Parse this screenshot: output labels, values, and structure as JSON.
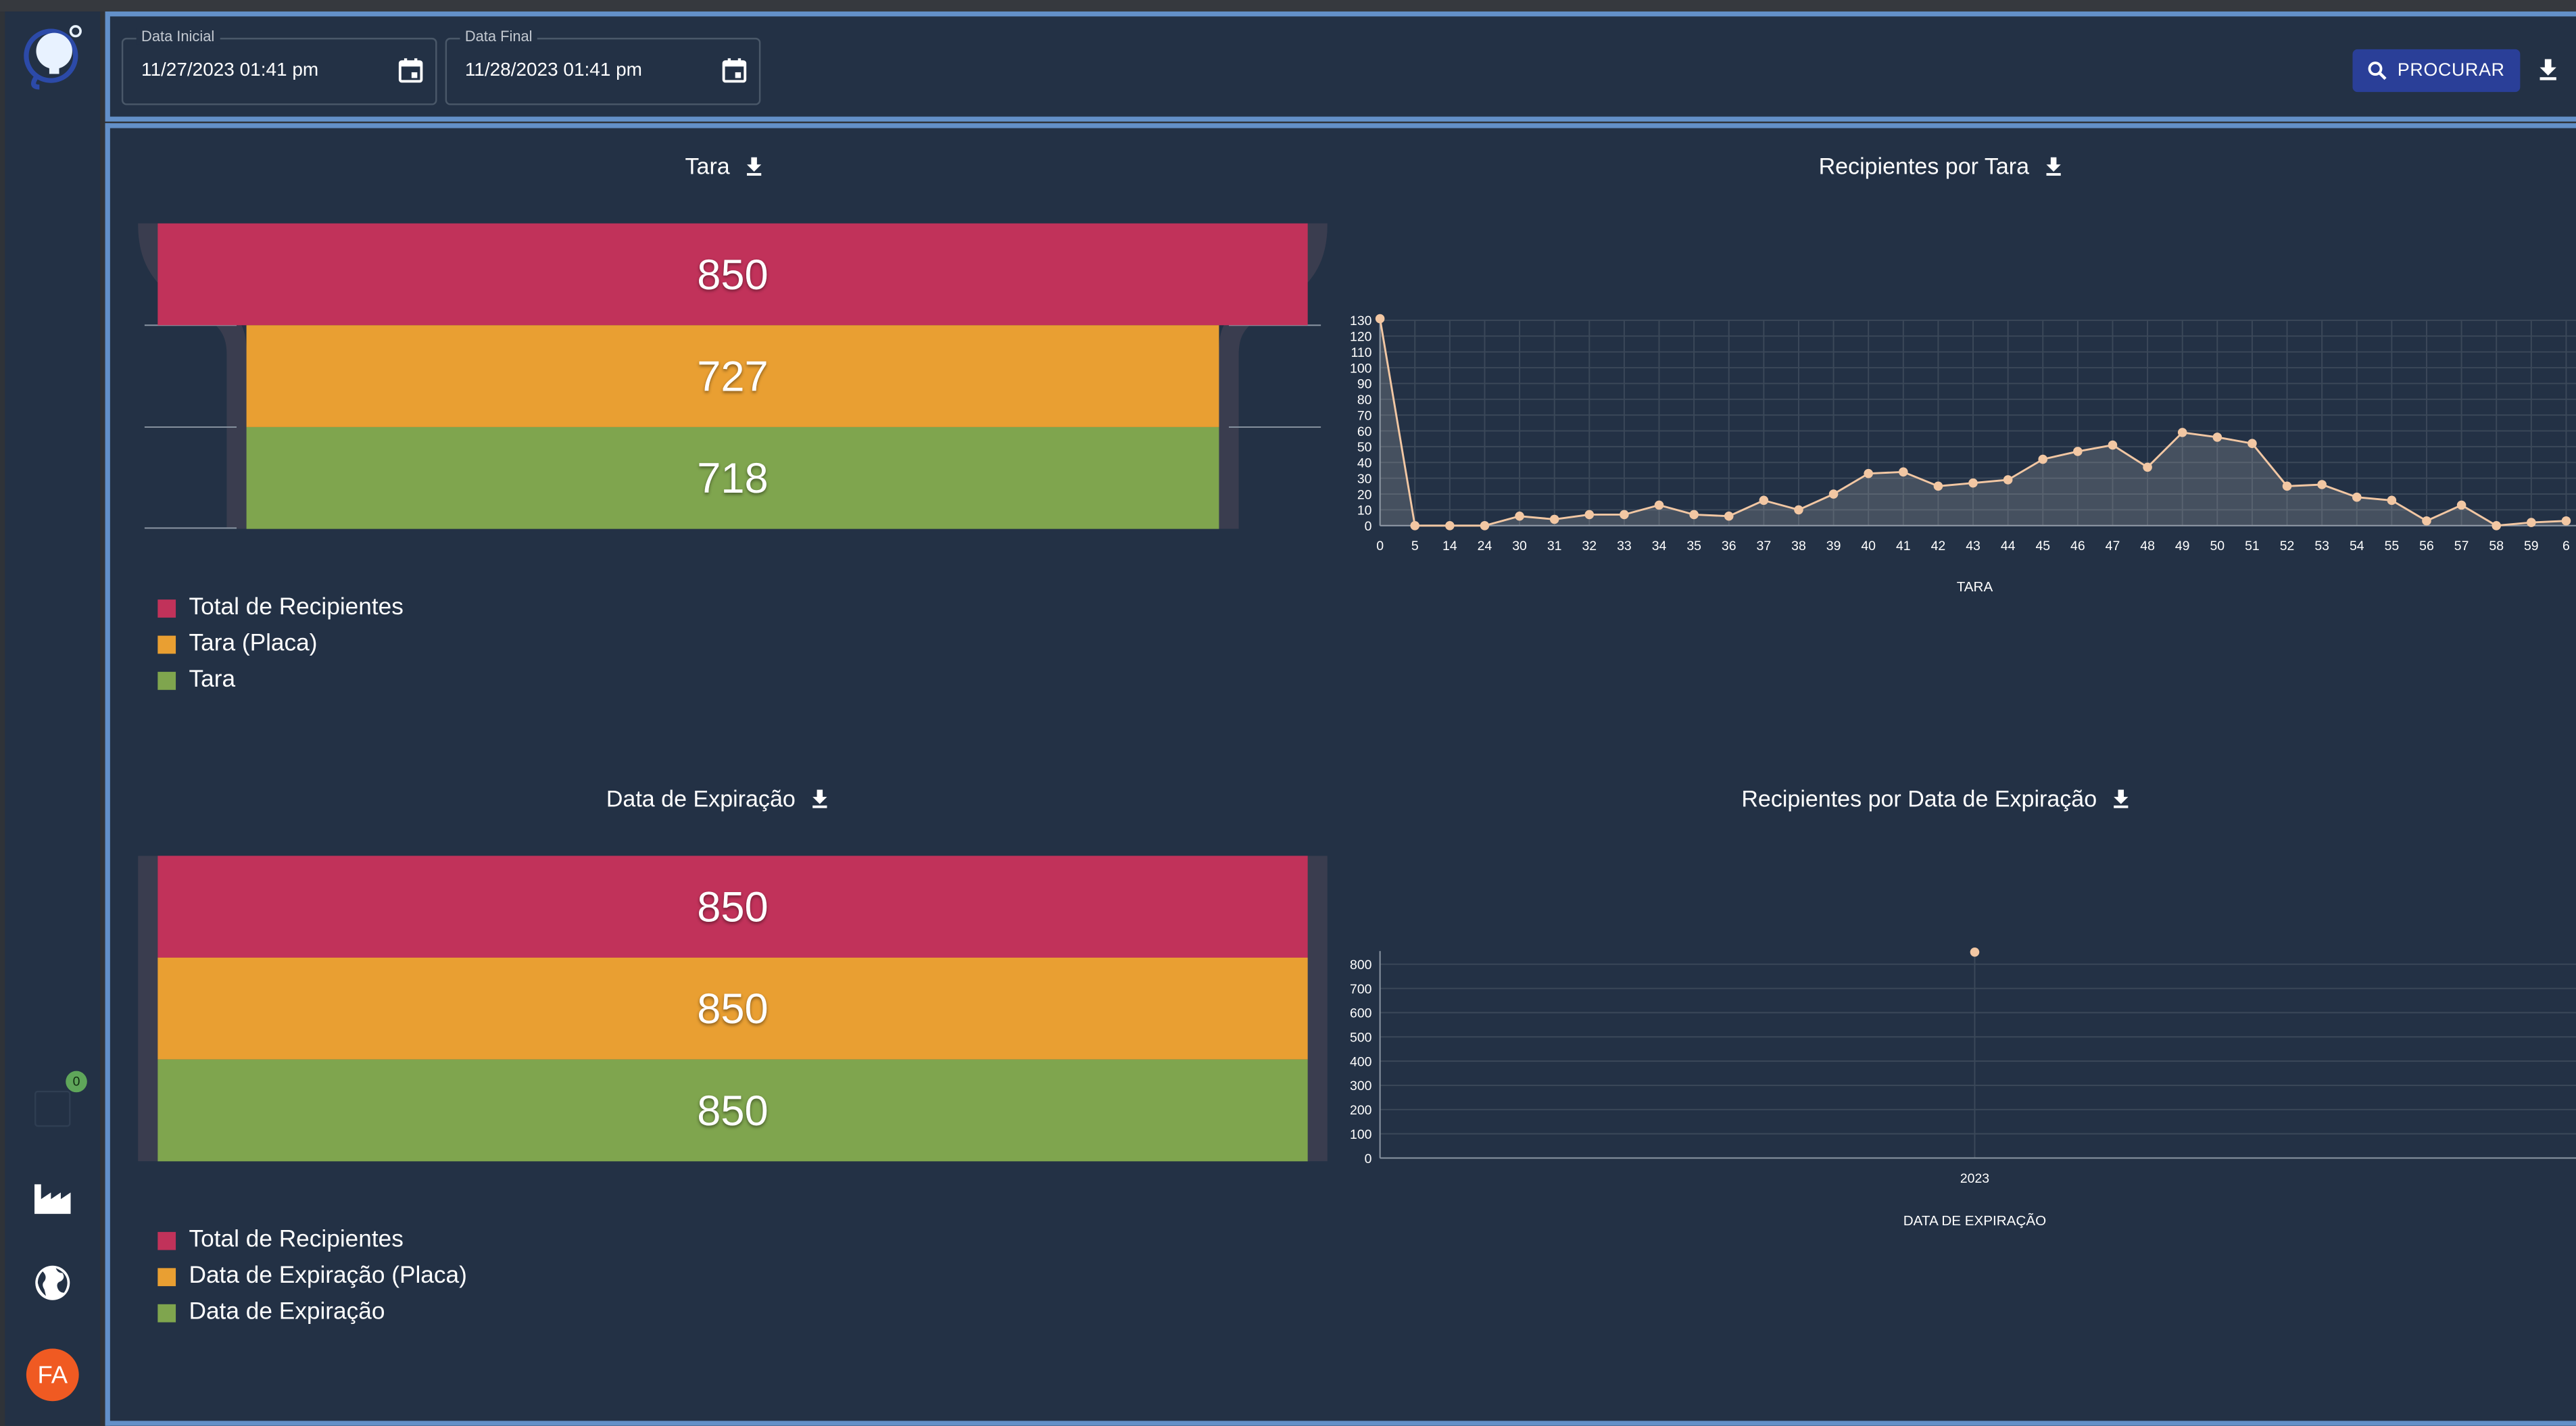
{
  "filters": {
    "start_label": "Data Inicial",
    "start_value": "11/27/2023 01:41 pm",
    "end_label": "Data Final",
    "end_value": "11/28/2023 01:41 pm",
    "search_label": "PROCURAR"
  },
  "sidebar": {
    "notification_count": "0",
    "avatar_initials": "FA"
  },
  "colors": {
    "total": "#c1325a",
    "placa": "#e99f32",
    "base": "#7fa54e",
    "line": "#f2c7a3"
  },
  "tara_funnel": {
    "title": "Tara",
    "values": [
      850,
      727,
      718
    ],
    "labels": [
      "850",
      "727",
      "718"
    ],
    "legend": [
      "Total de Recipientes",
      "Tara (Placa)",
      "Tara"
    ]
  },
  "expiracao_funnel": {
    "title": "Data de Expiração",
    "values": [
      850,
      850,
      850
    ],
    "labels": [
      "850",
      "850",
      "850"
    ],
    "legend": [
      "Total de Recipientes",
      "Data de Expiração (Placa)",
      "Data de Expiração"
    ]
  },
  "chart_data": [
    {
      "type": "line",
      "title": "Recipientes por Tara",
      "xlabel": "TARA",
      "ylabel": "",
      "ylim": [
        0,
        130
      ],
      "yticks": [
        0,
        10,
        20,
        30,
        40,
        50,
        60,
        70,
        80,
        90,
        100,
        110,
        120,
        130
      ],
      "grid": true,
      "categories": [
        "0",
        "5",
        "14",
        "24",
        "30",
        "31",
        "32",
        "33",
        "34",
        "35",
        "36",
        "37",
        "38",
        "39",
        "40",
        "41",
        "42",
        "43",
        "44",
        "45",
        "46",
        "47",
        "48",
        "49",
        "50",
        "51",
        "52",
        "53",
        "54",
        "55",
        "56",
        "57",
        "58",
        "59",
        "6"
      ],
      "values": [
        131,
        0,
        0,
        0,
        6,
        4,
        7,
        7,
        13,
        7,
        6,
        16,
        10,
        20,
        33,
        34,
        25,
        27,
        29,
        42,
        47,
        51,
        37,
        59,
        56,
        52,
        25,
        26,
        18,
        16,
        3,
        13,
        0,
        2,
        3
      ]
    },
    {
      "type": "scatter",
      "title": "Recipientes por Data de Expiração",
      "xlabel": "DATA DE EXPIRAÇÃO",
      "ylabel": "",
      "ylim": [
        0,
        800
      ],
      "yticks": [
        0,
        100,
        200,
        300,
        400,
        500,
        600,
        700,
        800
      ],
      "grid": true,
      "categories": [
        "2023"
      ],
      "values": [
        850
      ]
    }
  ]
}
